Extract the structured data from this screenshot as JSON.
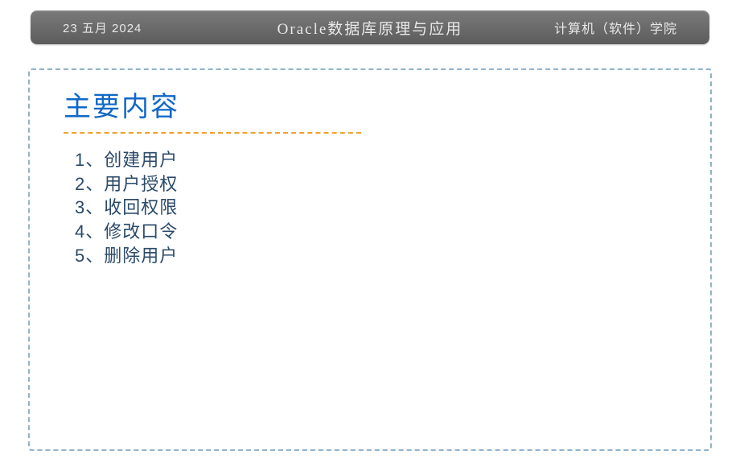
{
  "header": {
    "date": "23 五月 2024",
    "title": "Oracle数据库原理与应用",
    "organization": "计算机（软件）学院"
  },
  "section": {
    "title": "主要内容",
    "items": [
      "1、创建用户",
      "2、用户授权",
      "3、收回权限",
      "4、修改口令",
      "5、删除用户"
    ]
  }
}
